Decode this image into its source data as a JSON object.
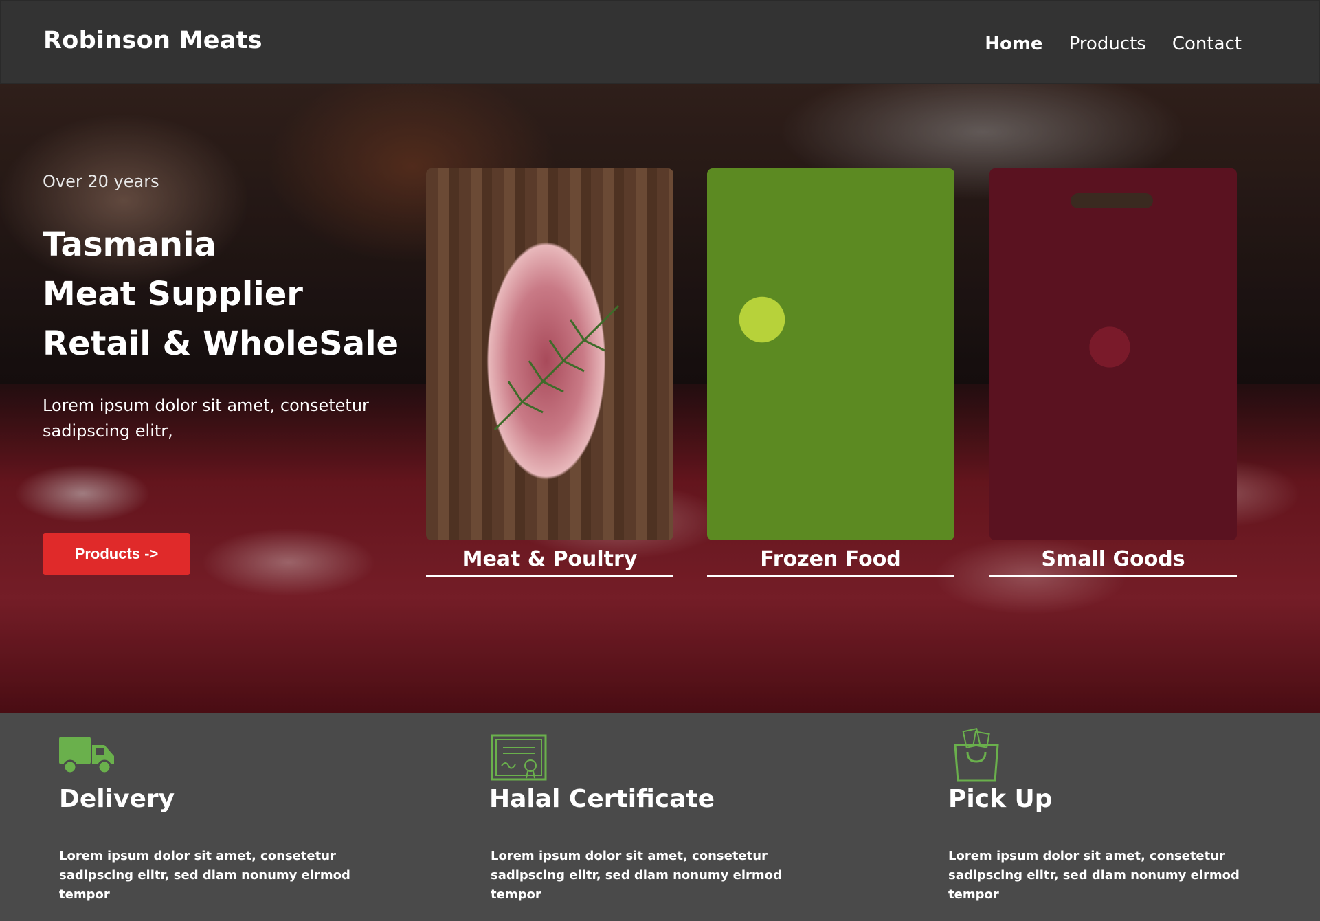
{
  "header": {
    "brand": "Robinson Meats",
    "nav": [
      {
        "label": "Home",
        "active": true
      },
      {
        "label": "Products",
        "active": false
      },
      {
        "label": "Contact",
        "active": false
      }
    ]
  },
  "hero": {
    "tagline": "Over 20 years",
    "headline": [
      "Tasmania",
      "Meat Supplier",
      "Retail & WholeSale"
    ],
    "description": "Lorem ipsum dolor sit amet, consetetur sadipscing elitr,",
    "button_label": "Products ->",
    "cards": [
      {
        "label": "Meat & Poultry",
        "image": "steak-photo"
      },
      {
        "label": "Frozen Food",
        "image": "frozen-vegetables-photo"
      },
      {
        "label": "Small Goods",
        "image": "charcuterie-board-photo"
      }
    ]
  },
  "features": [
    {
      "icon": "delivery-truck-icon",
      "title": "Delivery",
      "description": "Lorem ipsum dolor sit amet, consetetur sadipscing elitr, sed diam nonumy eirmod tempor"
    },
    {
      "icon": "certificate-icon",
      "title": "Halal Certificate",
      "description": "Lorem ipsum dolor sit amet, consetetur sadipscing elitr, sed diam nonumy eirmod tempor"
    },
    {
      "icon": "shopping-bag-icon",
      "title": "Pick Up",
      "description": "Lorem ipsum dolor sit amet, consetetur sadipscing elitr, sed diam nonumy eirmod tempor"
    }
  ],
  "colors": {
    "header_bg": "#333333",
    "features_bg": "#4a4a4a",
    "button_red": "#e02a2a",
    "icon_green": "#6ab04c"
  }
}
